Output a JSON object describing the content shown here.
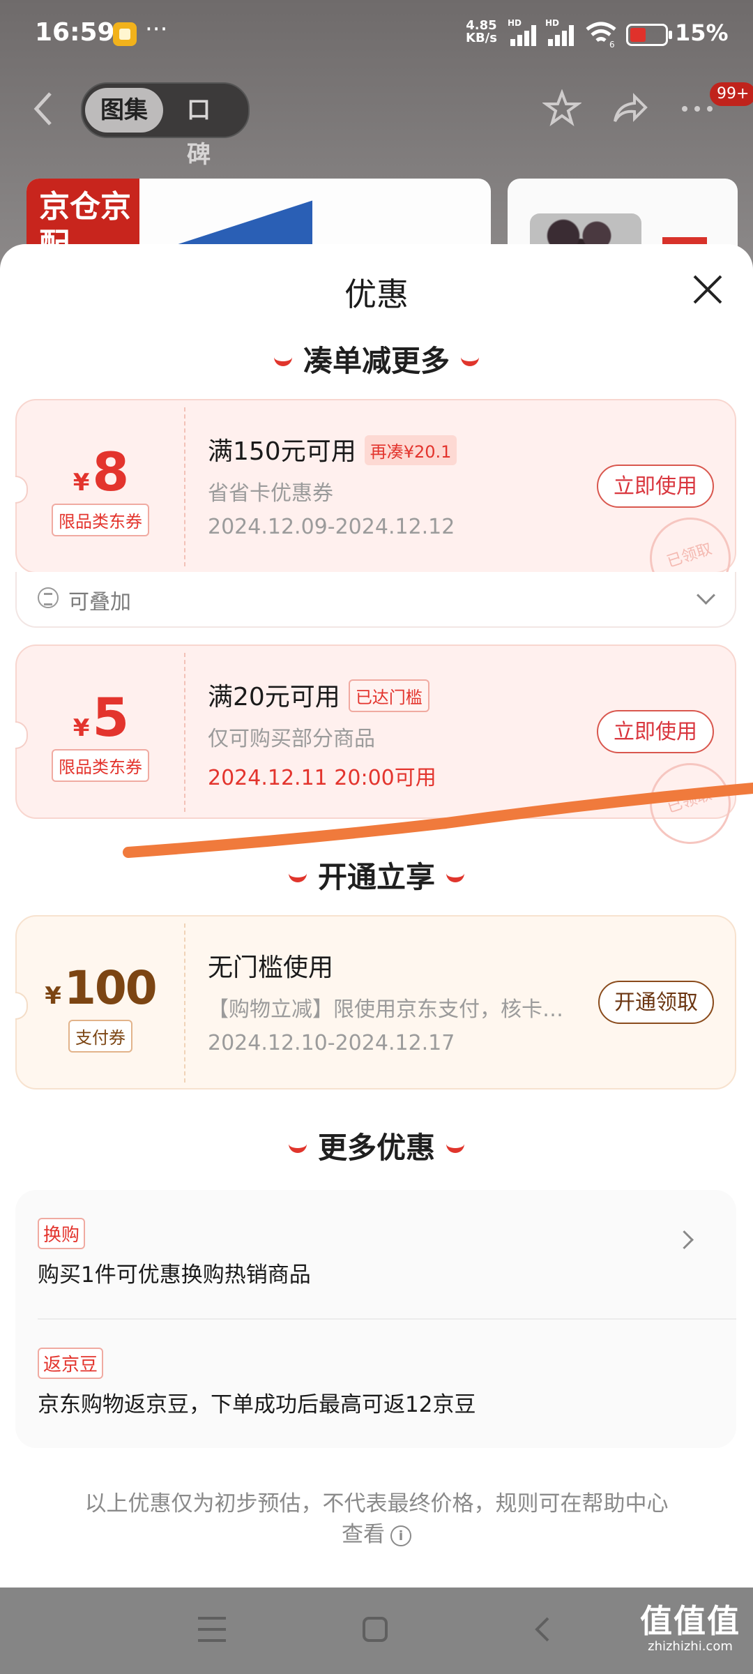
{
  "status_bar": {
    "time": "16:59",
    "dots": "···",
    "net_speed": "4.85",
    "net_unit": "KB/s",
    "hd1": "HD",
    "hd2": "HD",
    "wifi_num": "6",
    "battery_level": 0.15,
    "battery_text": "15%"
  },
  "header": {
    "tabs": [
      "图集",
      "口碑"
    ],
    "active_tab": "图集",
    "badge": "99+"
  },
  "background": {
    "thumb1_logo": "京仓京配"
  },
  "sheet": {
    "title": "优惠",
    "section1_title": "凑单减更多",
    "section2_title": "开通立享",
    "section3_title": "更多优惠"
  },
  "coupons": [
    {
      "currency": "¥",
      "amount": "8",
      "type": "限品类东券",
      "condition": "满150元可用",
      "condition_tag": "再凑¥20.1",
      "description": "省省卡优惠券",
      "date": "2024.12.09-2024.12.12",
      "button": "立即使用",
      "stamp": "已领取"
    },
    {
      "currency": "¥",
      "amount": "5",
      "type": "限品类东券",
      "condition": "满20元可用",
      "condition_tag": "已达门槛",
      "description": "仅可购买部分商品",
      "date": "2024.12.11 20:00可用",
      "button": "立即使用",
      "stamp": "已领取"
    },
    {
      "currency": "¥",
      "amount": "100",
      "type": "支付券",
      "condition": "无门槛使用",
      "description": "【购物立减】限使用京东支付，核卡…",
      "date": "2024.12.10-2024.12.17",
      "button": "开通领取"
    }
  ],
  "stackable_text": "可叠加",
  "more_offers": [
    {
      "tag": "换购",
      "text": "购买1件可优惠换购热销商品"
    },
    {
      "tag": "返京豆",
      "text": "京东购物返京豆，下单成功后最高可返12京豆"
    }
  ],
  "footer_note": "以上优惠仅为初步预估，不代表最终价格，规则可在帮助中心查看",
  "watermark": {
    "cn": "值值值",
    "url": "zhizhizhi.com"
  },
  "colors": {
    "accent": "#e3342d",
    "gold": "#7c4513",
    "annotation": "#f07a3c"
  }
}
